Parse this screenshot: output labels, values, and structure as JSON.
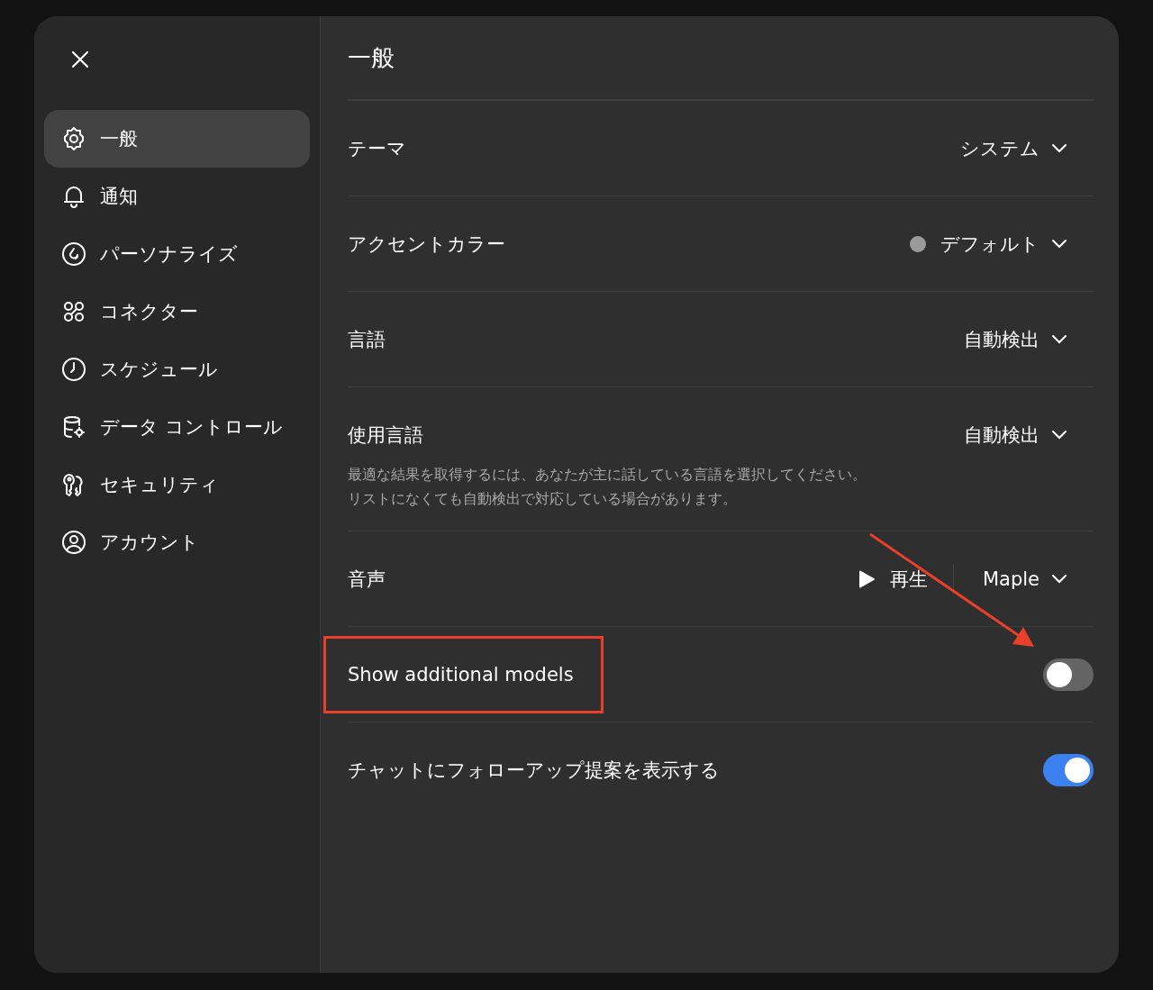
{
  "sidebar": {
    "items": [
      {
        "label": "一般",
        "selected": true
      },
      {
        "label": "通知",
        "selected": false
      },
      {
        "label": "パーソナライズ",
        "selected": false
      },
      {
        "label": "コネクター",
        "selected": false
      },
      {
        "label": "スケジュール",
        "selected": false
      },
      {
        "label": "データ コントロール",
        "selected": false
      },
      {
        "label": "セキュリティ",
        "selected": false
      },
      {
        "label": "アカウント",
        "selected": false
      }
    ]
  },
  "page": {
    "title": "一般"
  },
  "settings": [
    {
      "kind": "select",
      "label": "テーマ",
      "value": "システム"
    },
    {
      "kind": "select",
      "label": "アクセントカラー",
      "value": "デフォルト",
      "color": "#9a9a9a"
    },
    {
      "kind": "select",
      "label": "言語",
      "value": "自動検出"
    },
    {
      "kind": "select",
      "label": "使用言語",
      "value": "自動検出",
      "description": [
        "最適な結果を取得するには、あなたが主に話している言語を選択してください。",
        "リストになくても自動検出で対応している場合があります。"
      ]
    },
    {
      "kind": "voice",
      "label": "音声",
      "play": "再生",
      "value": "Maple"
    },
    {
      "kind": "toggle",
      "label": "Show additional models",
      "on": false,
      "highlighted": true
    },
    {
      "kind": "toggle",
      "label": "チャットにフォローアップ提案を表示する",
      "on": true,
      "highlighted": false
    }
  ]
}
